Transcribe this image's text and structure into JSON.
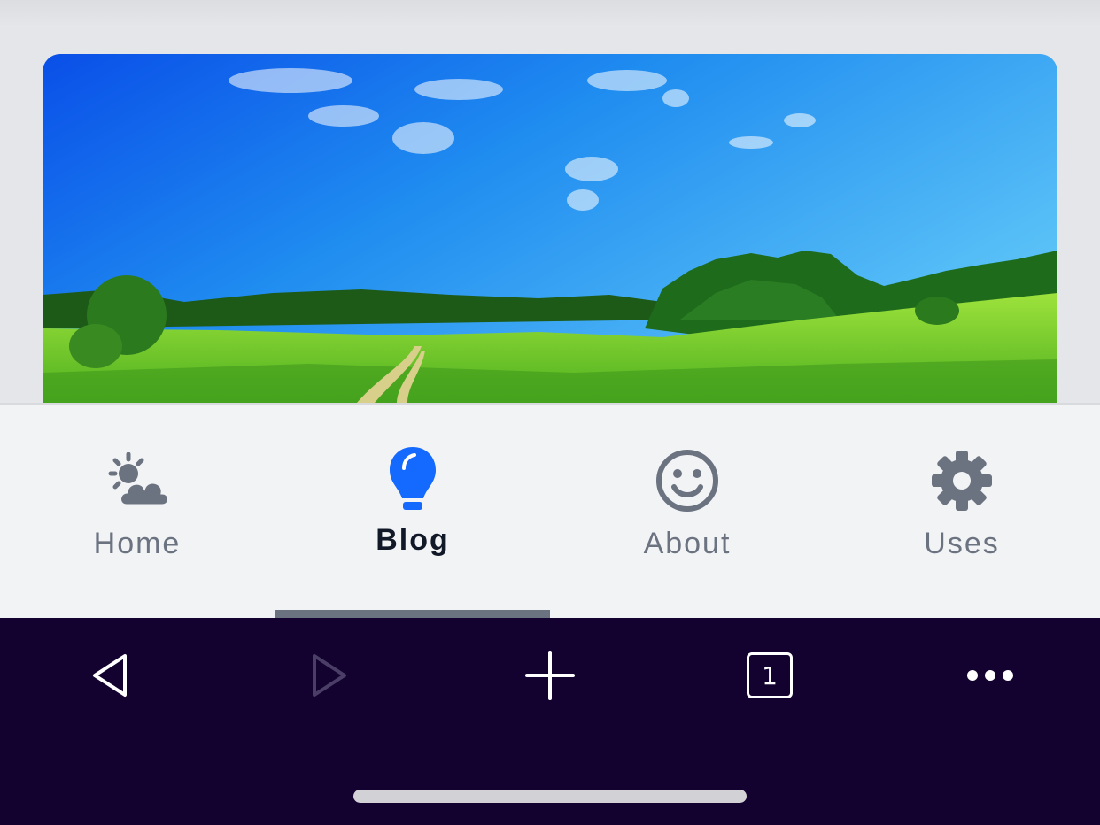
{
  "hero": {
    "image": "meadow-landscape-photo"
  },
  "nav": {
    "tabs": [
      {
        "label": "Home",
        "icon": "weather-sun-cloud-icon",
        "active": false
      },
      {
        "label": "Blog",
        "icon": "lightbulb-icon",
        "active": true
      },
      {
        "label": "About",
        "icon": "smiley-face-icon",
        "active": false
      },
      {
        "label": "Uses",
        "icon": "gear-icon",
        "active": false
      }
    ],
    "colors": {
      "active_icon": "#1469ff",
      "inactive_icon": "#6b7280",
      "active_label": "#111827"
    }
  },
  "browser": {
    "tab_count": "1",
    "buttons": [
      "back-icon",
      "forward-icon",
      "new-tab-icon",
      "tabs-icon",
      "more-icon"
    ],
    "background": "#13022f"
  }
}
